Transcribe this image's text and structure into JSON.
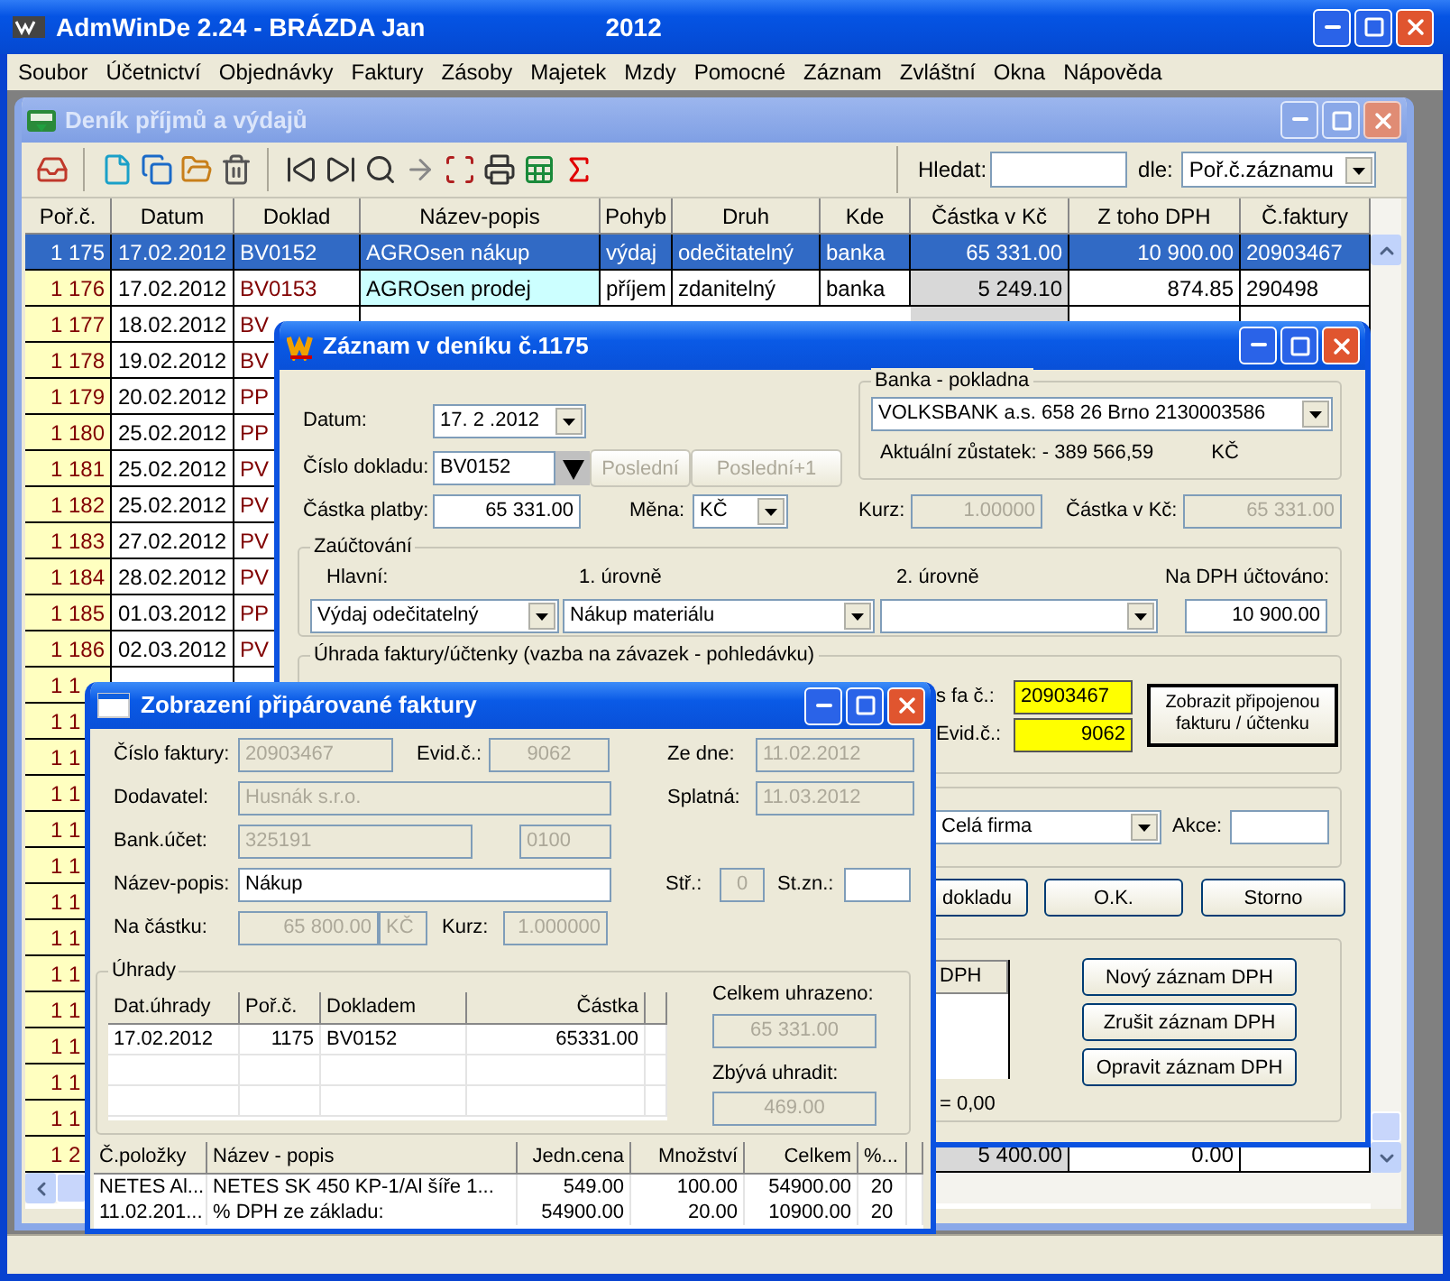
{
  "app": {
    "title": "AdmWinDe 2.24 - BRÁZDA Jan",
    "year": "2012"
  },
  "menu": [
    "Soubor",
    "Účetnictví",
    "Objednávky",
    "Faktury",
    "Zásoby",
    "Majetek",
    "Mzdy",
    "Pomocné",
    "Záznam",
    "Zvláštní",
    "Okna",
    "Nápověda"
  ],
  "journal": {
    "title": "Deník příjmů a výdajů",
    "search_label": "Hledat:",
    "by_label": "dle:",
    "by_value": "Poř.č.záznamu",
    "columns": [
      "Poř.č.",
      "Datum",
      "Doklad",
      "Název-popis",
      "Pohyb",
      "Druh",
      "Kde",
      "Částka v Kč",
      "Z toho DPH",
      "Č.faktury"
    ],
    "rows": [
      {
        "kind": "full",
        "selected": true,
        "cells": [
          "1 175",
          "17.02.2012",
          "BV0152",
          "AGROsen nákup",
          "výdaj",
          "odečitatelný",
          "banka",
          "65 331.00",
          "10 900.00",
          "20903467"
        ]
      },
      {
        "kind": "full",
        "selected": false,
        "cells": [
          "1 176",
          "17.02.2012",
          "BV0153",
          "AGROsen prodej",
          "příjem",
          "zdanitelný",
          "banka",
          "5 249.10",
          "874.85",
          "290498"
        ]
      },
      {
        "kind": "full",
        "selected": false,
        "cells": [
          "1 177",
          "18.02.2012",
          "BV"
        ]
      },
      {
        "kind": "full",
        "selected": false,
        "cells": [
          "1 178",
          "19.02.2012",
          "BV"
        ]
      },
      {
        "kind": "full",
        "selected": false,
        "cells": [
          "1 179",
          "20.02.2012",
          "PP"
        ]
      },
      {
        "kind": "full",
        "selected": false,
        "cells": [
          "1 180",
          "25.02.2012",
          "PP"
        ]
      },
      {
        "kind": "full",
        "selected": false,
        "cells": [
          "1 181",
          "25.02.2012",
          "PV"
        ]
      },
      {
        "kind": "full",
        "selected": false,
        "cells": [
          "1 182",
          "25.02.2012",
          "PV"
        ]
      },
      {
        "kind": "full",
        "selected": false,
        "cells": [
          "1 183",
          "27.02.2012",
          "PV"
        ]
      },
      {
        "kind": "full",
        "selected": false,
        "cells": [
          "1 184",
          "28.02.2012",
          "PV"
        ]
      },
      {
        "kind": "full",
        "selected": false,
        "cells": [
          "1 185",
          "01.03.2012",
          "PP"
        ]
      },
      {
        "kind": "full",
        "selected": false,
        "cells": [
          "1 186",
          "02.03.2012",
          "PV"
        ]
      },
      {
        "kind": "covered",
        "selected": false,
        "cells": [
          "1 1"
        ]
      },
      {
        "kind": "covered",
        "selected": false,
        "cells": [
          "1 1"
        ]
      },
      {
        "kind": "covered",
        "selected": false,
        "cells": [
          "1 1"
        ]
      },
      {
        "kind": "covered",
        "selected": false,
        "cells": [
          "1 1"
        ]
      },
      {
        "kind": "covered",
        "selected": false,
        "cells": [
          "1 1"
        ]
      },
      {
        "kind": "covered",
        "selected": false,
        "cells": [
          "1 1"
        ]
      },
      {
        "kind": "covered",
        "selected": false,
        "cells": [
          "1 1"
        ]
      },
      {
        "kind": "covered",
        "selected": false,
        "cells": [
          "1 1"
        ]
      },
      {
        "kind": "covered",
        "selected": false,
        "cells": [
          "1 1"
        ]
      },
      {
        "kind": "covered",
        "selected": false,
        "cells": [
          "1 1"
        ]
      },
      {
        "kind": "covered",
        "selected": false,
        "cells": [
          "1 1"
        ]
      },
      {
        "kind": "covered",
        "selected": false,
        "cells": [
          "1 1"
        ]
      },
      {
        "kind": "covered",
        "selected": false,
        "cells": [
          "1 1"
        ]
      },
      {
        "kind": "covered",
        "selected": false,
        "cells": [
          "1 2",
          null,
          null,
          null,
          null,
          null,
          null,
          "5 400.00",
          "0.00"
        ]
      }
    ]
  },
  "record": {
    "title": "Záznam v deníku č.1175",
    "date": {
      "label": "Datum:",
      "value": "17. 2 .2012"
    },
    "doc": {
      "label": "Číslo dokladu:",
      "value": "BV0152"
    },
    "last_buttons": [
      {
        "label": "Poslední",
        "disabled": true
      },
      {
        "label": "Poslední+1",
        "disabled": true
      }
    ],
    "amount": {
      "label": "Částka platby:",
      "value": "65 331.00"
    },
    "currency": {
      "label": "Měna:",
      "value": "KČ"
    },
    "rate": {
      "label": "Kurz:",
      "value": "1.00000",
      "disabled": true
    },
    "amount_czk": {
      "label": "Částka v Kč:",
      "value": "65 331.00",
      "disabled": true
    },
    "bank": {
      "title": "Banka - pokladna",
      "value": "VOLKSBANK a.s. 658 26 Brno 2130003586",
      "balance": "Aktuální zůstatek: - 389 566,59",
      "currency": "KČ"
    },
    "posting": {
      "title": "Zaúčtování",
      "main_label": "Hlavní:",
      "main": "Výdaj odečitatelný",
      "level1_label": "1. úrovně",
      "level1": "Nákup materiálu",
      "level2_label": "2. úrovně",
      "vat_label": "Na DPH účtováno:",
      "vat": "10 900.00"
    },
    "payment": {
      "title": "Úhrada faktury/účtenky (vazba na závazek - pohledávku)",
      "invoice_label": "s fa č.:",
      "invoice": "20903467",
      "evid_label": "Evid.č.:",
      "evid": "9062",
      "show_button": "Zobrazit připojenou fakturu / účtenku"
    },
    "division": {
      "value": "Celá firma",
      "action_label": "Akce:"
    },
    "buttons": [
      "dokladu",
      "O.K.",
      "Storno"
    ],
    "vat_table": {
      "column": "DPH",
      "total": "= 0,00"
    },
    "vat_buttons": [
      "Nový záznam DPH",
      "Zrušit záznam DPH",
      "Opravit záznam DPH"
    ]
  },
  "invoice": {
    "title": "Zobrazení připárované faktury",
    "number": {
      "label": "Číslo faktury:",
      "value": "20903467",
      "disabled": true
    },
    "evid": {
      "label": "Evid.č.:",
      "value": "9062",
      "disabled": true
    },
    "issued": {
      "label": "Ze dne:",
      "value": "11.02.2012",
      "disabled": true
    },
    "supplier": {
      "label": "Dodavatel:",
      "value": "Husnák s.r.o.",
      "disabled": true
    },
    "due": {
      "label": "Splatná:",
      "value": "11.03.2012",
      "disabled": true
    },
    "account": {
      "label": "Bank.účet:",
      "value": "325191",
      "bank_code": "0100",
      "disabled": true
    },
    "description": {
      "label": "Název-popis:",
      "value": "Nákup",
      "disabled": false
    },
    "center": {
      "label": "Stř.:",
      "value": "0",
      "disabled": true
    },
    "symbol": {
      "label": "St.zn.:",
      "disabled": false
    },
    "amount": {
      "label": "Na částku:",
      "value": "65 800.00",
      "currency": "KČ",
      "disabled": true
    },
    "rate": {
      "label": "Kurz:",
      "value": "1.000000",
      "disabled": true
    },
    "payments": {
      "title": "Úhrady",
      "columns": [
        "Dat.úhrady",
        "Poř.č.",
        "Dokladem",
        "Částka"
      ],
      "rows": [
        [
          "17.02.2012",
          "1175",
          "BV0152",
          "65331.00"
        ]
      ],
      "paid_label": "Celkem uhrazeno:",
      "paid": "65 331.00",
      "remaining_label": "Zbývá uhradit:",
      "remaining": "469.00"
    },
    "items": {
      "columns": [
        "Č.položky",
        "Název - popis",
        "Jedn.cena",
        "Množství",
        "Celkem",
        "%..."
      ],
      "rows": [
        [
          "NETES Al...",
          "NETES SK 450 KP-1/Al šíře 1...",
          "549.00",
          "100.00",
          "54900.00",
          "20"
        ],
        [
          "11.02.201...",
          "% DPH ze základu:",
          "54900.00",
          "20.00",
          "10900.00",
          "20"
        ]
      ]
    }
  }
}
